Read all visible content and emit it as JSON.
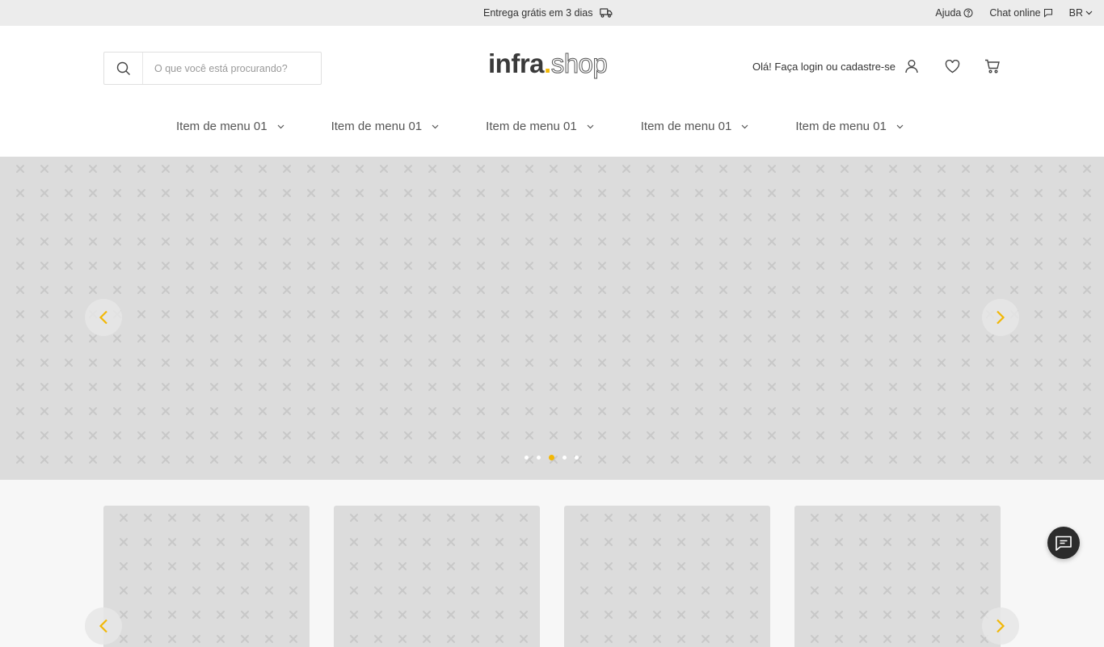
{
  "topbar": {
    "promo_text": "Entrega grátis em 3 dias",
    "promo_icon": "truck-icon",
    "links": [
      {
        "label": "Ajuda",
        "icon": "help-circle-icon"
      },
      {
        "label": "Chat online",
        "icon": "chat-bubble-icon"
      },
      {
        "label": "BR",
        "icon": "chevron-down-icon"
      }
    ]
  },
  "header": {
    "search": {
      "placeholder": "O que você está procurando?",
      "value": "",
      "icon": "search-icon"
    },
    "logo": {
      "part1": "infra",
      "dot": ".",
      "part2": "shop"
    },
    "account": {
      "login_text": "Olá! Faça login ou cadastre-se",
      "icons": [
        "user-icon",
        "heart-icon",
        "cart-icon"
      ]
    }
  },
  "nav": {
    "items": [
      {
        "label": "Item de menu 01"
      },
      {
        "label": "Item de menu 01"
      },
      {
        "label": "Item de menu 01"
      },
      {
        "label": "Item de menu 01"
      },
      {
        "label": "Item de menu 01"
      }
    ]
  },
  "hero": {
    "slide_count": 5,
    "active_slide": 3,
    "prev_icon": "chevron-left-icon",
    "next_icon": "chevron-right-icon"
  },
  "cards": {
    "count": 4
  },
  "colors": {
    "accent": "#f2b705",
    "topbar_bg": "#ececec",
    "placeholder_bg": "#dcdcdc",
    "pattern_mark": "#c8c8c8",
    "chat_fab_bg": "#2b2b2b"
  },
  "chat_fab": {
    "icon": "chat-icon"
  }
}
